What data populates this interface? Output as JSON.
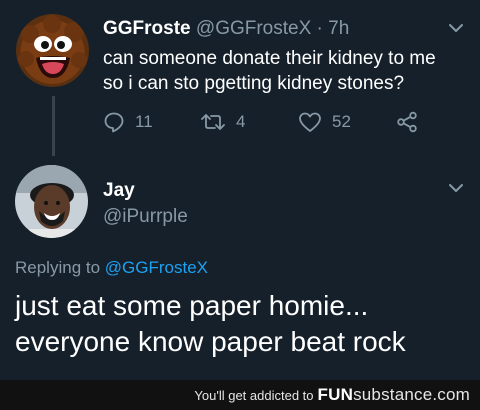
{
  "tweet1": {
    "display_name": "GGFroste",
    "handle_time": "@GGFrosteX · 7h",
    "body": "can someone donate their kidney to me so i can sto pgetting kidney stones?",
    "replies": "11",
    "retweets": "4",
    "likes": "52"
  },
  "tweet2": {
    "display_name": "Jay",
    "handle": "@iPurrple",
    "replying_prefix": "Replying to",
    "replying_mention": "@GGFrosteX",
    "body": "just eat some paper homie... everyone know paper beat rock"
  },
  "footer": {
    "tagline": "You'll get addicted to",
    "brand_fun": "FUN",
    "brand_rest": "substance.com"
  },
  "colors": {
    "background": "#15202b",
    "secondary_text": "#8899a6",
    "link": "#1da1f2"
  }
}
